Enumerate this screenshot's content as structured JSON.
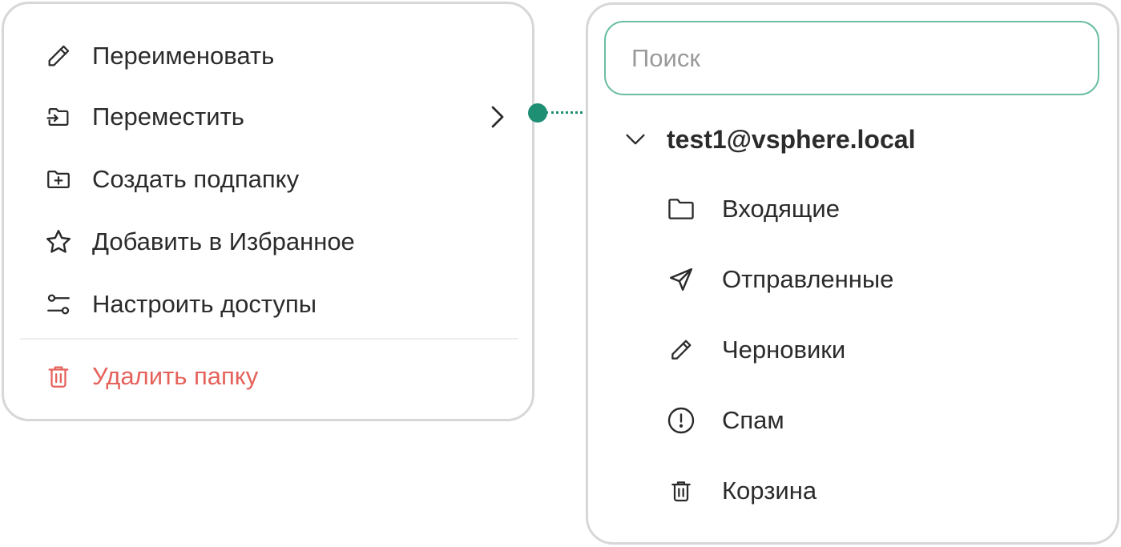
{
  "context_menu": {
    "items": [
      {
        "label": "Переименовать",
        "icon": "pencil-icon"
      },
      {
        "label": "Переместить",
        "icon": "move-folder-icon"
      },
      {
        "label": "Создать подпапку",
        "icon": "folder-plus-icon"
      },
      {
        "label": "Добавить в Избранное",
        "icon": "star-icon"
      },
      {
        "label": "Настроить доступы",
        "icon": "access-settings-icon"
      }
    ],
    "delete_item": {
      "label": "Удалить папку",
      "icon": "trash-icon"
    },
    "submenu_indicator_icon": "chevron-right-icon"
  },
  "folder_picker": {
    "search": {
      "placeholder": "Поиск",
      "value": ""
    },
    "account": {
      "label": "test1@vsphere.local",
      "expanded": true
    },
    "folders": [
      {
        "label": "Входящие",
        "icon": "folder-icon"
      },
      {
        "label": "Отправленные",
        "icon": "send-icon"
      },
      {
        "label": "Черновики",
        "icon": "pencil-icon"
      },
      {
        "label": "Спам",
        "icon": "alert-circle-icon"
      },
      {
        "label": "Корзина",
        "icon": "trash-icon"
      }
    ]
  },
  "colors": {
    "text": "#2b2b2b",
    "danger": "#e5625b",
    "accent": "#1f8f74",
    "search_border": "#6bbea2",
    "panel_border": "#d7d7d7",
    "placeholder": "#9a9a9a"
  }
}
